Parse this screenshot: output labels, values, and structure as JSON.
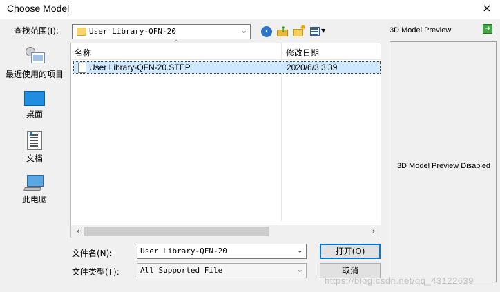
{
  "window": {
    "title": "Choose Model",
    "close_icon": "×"
  },
  "toolbar": {
    "look_in_label": "查找范围(I):",
    "look_in_value": "User Library-QFN-20",
    "back_icon": "back-arrow-icon",
    "up_icon": "up-folder-icon",
    "new_folder_icon": "new-folder-icon",
    "view_icon": "view-menu-icon"
  },
  "places": [
    {
      "label": "最近使用的项目",
      "icon": "recent-items-icon"
    },
    {
      "label": "桌面",
      "icon": "desktop-icon"
    },
    {
      "label": "文档",
      "icon": "documents-icon"
    },
    {
      "label": "此电脑",
      "icon": "this-pc-icon"
    }
  ],
  "file_list": {
    "columns": [
      "名称",
      "修改日期"
    ],
    "rows": [
      {
        "name": "User Library-QFN-20.STEP",
        "date": "2020/6/3 3:39",
        "selected": true
      }
    ]
  },
  "filename": {
    "label": "文件名(N):",
    "value": "User Library-QFN-20"
  },
  "filetype": {
    "label": "文件类型(T):",
    "value": "All Supported File"
  },
  "buttons": {
    "open": "打开(O)",
    "cancel": "取消"
  },
  "preview": {
    "title": "3D Model Preview",
    "message": "3D Model Preview Disabled"
  },
  "watermark": "https://blog.csdn.net/qq_43122639",
  "colors": {
    "selection": "#cde8ff",
    "accent": "#0078d7"
  }
}
